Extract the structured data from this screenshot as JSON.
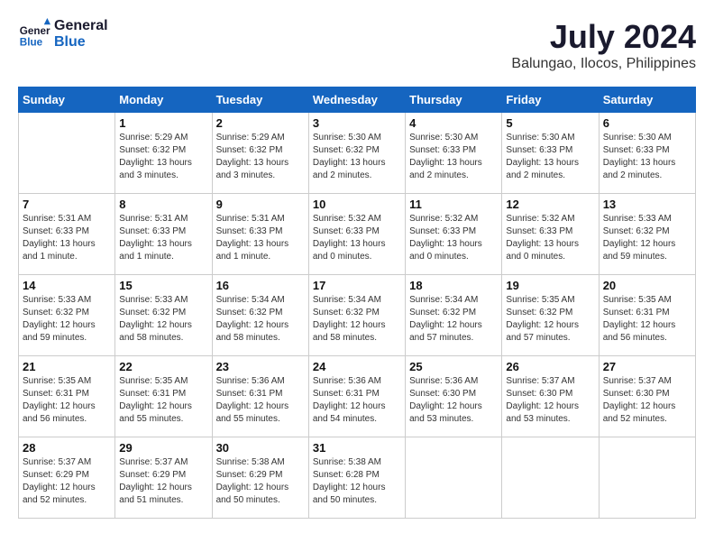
{
  "header": {
    "logo_line1": "General",
    "logo_line2": "Blue",
    "main_title": "July 2024",
    "subtitle": "Balungao, Ilocos, Philippines"
  },
  "days_of_week": [
    "Sunday",
    "Monday",
    "Tuesday",
    "Wednesday",
    "Thursday",
    "Friday",
    "Saturday"
  ],
  "weeks": [
    [
      {
        "day": "",
        "info": ""
      },
      {
        "day": "1",
        "info": "Sunrise: 5:29 AM\nSunset: 6:32 PM\nDaylight: 13 hours\nand 3 minutes."
      },
      {
        "day": "2",
        "info": "Sunrise: 5:29 AM\nSunset: 6:32 PM\nDaylight: 13 hours\nand 3 minutes."
      },
      {
        "day": "3",
        "info": "Sunrise: 5:30 AM\nSunset: 6:32 PM\nDaylight: 13 hours\nand 2 minutes."
      },
      {
        "day": "4",
        "info": "Sunrise: 5:30 AM\nSunset: 6:33 PM\nDaylight: 13 hours\nand 2 minutes."
      },
      {
        "day": "5",
        "info": "Sunrise: 5:30 AM\nSunset: 6:33 PM\nDaylight: 13 hours\nand 2 minutes."
      },
      {
        "day": "6",
        "info": "Sunrise: 5:30 AM\nSunset: 6:33 PM\nDaylight: 13 hours\nand 2 minutes."
      }
    ],
    [
      {
        "day": "7",
        "info": "Sunrise: 5:31 AM\nSunset: 6:33 PM\nDaylight: 13 hours\nand 1 minute."
      },
      {
        "day": "8",
        "info": "Sunrise: 5:31 AM\nSunset: 6:33 PM\nDaylight: 13 hours\nand 1 minute."
      },
      {
        "day": "9",
        "info": "Sunrise: 5:31 AM\nSunset: 6:33 PM\nDaylight: 13 hours\nand 1 minute."
      },
      {
        "day": "10",
        "info": "Sunrise: 5:32 AM\nSunset: 6:33 PM\nDaylight: 13 hours\nand 0 minutes."
      },
      {
        "day": "11",
        "info": "Sunrise: 5:32 AM\nSunset: 6:33 PM\nDaylight: 13 hours\nand 0 minutes."
      },
      {
        "day": "12",
        "info": "Sunrise: 5:32 AM\nSunset: 6:33 PM\nDaylight: 13 hours\nand 0 minutes."
      },
      {
        "day": "13",
        "info": "Sunrise: 5:33 AM\nSunset: 6:32 PM\nDaylight: 12 hours\nand 59 minutes."
      }
    ],
    [
      {
        "day": "14",
        "info": "Sunrise: 5:33 AM\nSunset: 6:32 PM\nDaylight: 12 hours\nand 59 minutes."
      },
      {
        "day": "15",
        "info": "Sunrise: 5:33 AM\nSunset: 6:32 PM\nDaylight: 12 hours\nand 58 minutes."
      },
      {
        "day": "16",
        "info": "Sunrise: 5:34 AM\nSunset: 6:32 PM\nDaylight: 12 hours\nand 58 minutes."
      },
      {
        "day": "17",
        "info": "Sunrise: 5:34 AM\nSunset: 6:32 PM\nDaylight: 12 hours\nand 58 minutes."
      },
      {
        "day": "18",
        "info": "Sunrise: 5:34 AM\nSunset: 6:32 PM\nDaylight: 12 hours\nand 57 minutes."
      },
      {
        "day": "19",
        "info": "Sunrise: 5:35 AM\nSunset: 6:32 PM\nDaylight: 12 hours\nand 57 minutes."
      },
      {
        "day": "20",
        "info": "Sunrise: 5:35 AM\nSunset: 6:31 PM\nDaylight: 12 hours\nand 56 minutes."
      }
    ],
    [
      {
        "day": "21",
        "info": "Sunrise: 5:35 AM\nSunset: 6:31 PM\nDaylight: 12 hours\nand 56 minutes."
      },
      {
        "day": "22",
        "info": "Sunrise: 5:35 AM\nSunset: 6:31 PM\nDaylight: 12 hours\nand 55 minutes."
      },
      {
        "day": "23",
        "info": "Sunrise: 5:36 AM\nSunset: 6:31 PM\nDaylight: 12 hours\nand 55 minutes."
      },
      {
        "day": "24",
        "info": "Sunrise: 5:36 AM\nSunset: 6:31 PM\nDaylight: 12 hours\nand 54 minutes."
      },
      {
        "day": "25",
        "info": "Sunrise: 5:36 AM\nSunset: 6:30 PM\nDaylight: 12 hours\nand 53 minutes."
      },
      {
        "day": "26",
        "info": "Sunrise: 5:37 AM\nSunset: 6:30 PM\nDaylight: 12 hours\nand 53 minutes."
      },
      {
        "day": "27",
        "info": "Sunrise: 5:37 AM\nSunset: 6:30 PM\nDaylight: 12 hours\nand 52 minutes."
      }
    ],
    [
      {
        "day": "28",
        "info": "Sunrise: 5:37 AM\nSunset: 6:29 PM\nDaylight: 12 hours\nand 52 minutes."
      },
      {
        "day": "29",
        "info": "Sunrise: 5:37 AM\nSunset: 6:29 PM\nDaylight: 12 hours\nand 51 minutes."
      },
      {
        "day": "30",
        "info": "Sunrise: 5:38 AM\nSunset: 6:29 PM\nDaylight: 12 hours\nand 50 minutes."
      },
      {
        "day": "31",
        "info": "Sunrise: 5:38 AM\nSunset: 6:28 PM\nDaylight: 12 hours\nand 50 minutes."
      },
      {
        "day": "",
        "info": ""
      },
      {
        "day": "",
        "info": ""
      },
      {
        "day": "",
        "info": ""
      }
    ]
  ]
}
